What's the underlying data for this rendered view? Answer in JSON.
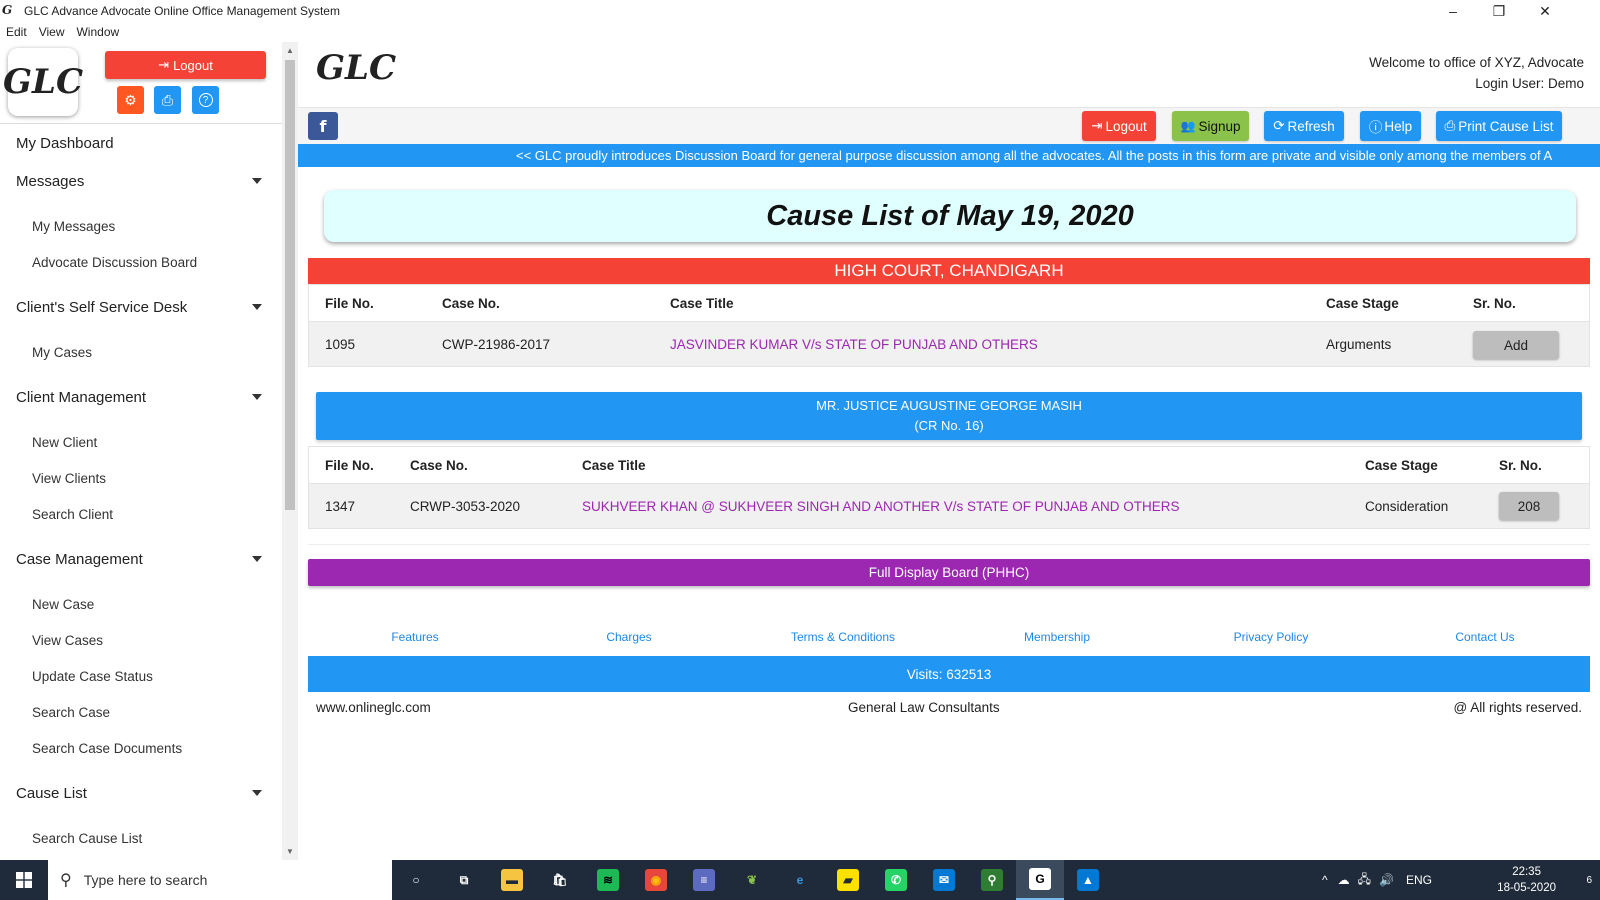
{
  "window": {
    "title": "GLC Advance Advocate Online Office Management System",
    "icon": "glc-app-icon",
    "minimize": "–",
    "restore": "❐",
    "close": "✕"
  },
  "menubar": [
    "Edit",
    "View",
    "Window"
  ],
  "sidebar": {
    "logo_text": "GLC",
    "logout_label": "Logout",
    "icon_buttons": [
      {
        "name": "settings-button",
        "icon": "gear-icon",
        "glyph": "⚙",
        "color": "#ff5722"
      },
      {
        "name": "print-button",
        "icon": "print-icon",
        "glyph": "⎙",
        "color": "#2196f3"
      },
      {
        "name": "help-button",
        "icon": "help-icon",
        "glyph": "?",
        "color": "#2196f3"
      }
    ],
    "dashboard": "My Dashboard",
    "groups": [
      {
        "label": "Messages",
        "items": [
          "My Messages",
          "Advocate Discussion Board"
        ]
      },
      {
        "label": "Client's Self Service Desk",
        "items": [
          "My Cases"
        ]
      },
      {
        "label": "Client Management",
        "items": [
          "New Client",
          "View Clients",
          "Search Client"
        ]
      },
      {
        "label": "Case Management",
        "items": [
          "New Case",
          "View Cases",
          "Update Case Status",
          "Search Case",
          "Search Case Documents"
        ]
      },
      {
        "label": "Cause List",
        "items": [
          "Search Cause List"
        ]
      }
    ]
  },
  "header": {
    "logo_text": "GLC",
    "welcome": "Welcome to office of XYZ, Advocate",
    "login_user": "Login User: Demo"
  },
  "toolbar": {
    "facebook": "f",
    "buttons": [
      {
        "name": "logout-button",
        "label": "Logout",
        "glyph": "⇥",
        "color": "#f44336"
      },
      {
        "name": "signup-button",
        "label": "Signup",
        "glyph": "👥",
        "color": "#8bc34a"
      },
      {
        "name": "refresh-button",
        "label": "Refresh",
        "glyph": "⟳",
        "color": "#2196f3"
      },
      {
        "name": "help-button",
        "label": "Help",
        "glyph": "ⓘ",
        "color": "#2196f3"
      },
      {
        "name": "print-cause-list-button",
        "label": "Print Cause List",
        "glyph": "⎙",
        "color": "#2196f3"
      }
    ]
  },
  "marquee": "<< GLC proudly introduces Discussion Board for general purpose discussion among all the advocates. All the posts in this form are private and visible only among the members of A",
  "cause_list": {
    "title": "Cause List of May 19, 2020",
    "court": "HIGH COURT, CHANDIGARH",
    "table1": {
      "headers": [
        "File No.",
        "Case No.",
        "Case Title",
        "Case Stage",
        "Sr. No."
      ],
      "rows": [
        {
          "file_no": "1095",
          "case_no": "CWP-21986-2017",
          "title": "JASVINDER KUMAR V/s STATE OF PUNJAB AND OTHERS",
          "stage": "Arguments",
          "sr": "Add"
        }
      ]
    },
    "judge": {
      "name": "MR. JUSTICE AUGUSTINE GEORGE MASIH",
      "room": "(CR No. 16)"
    },
    "table2": {
      "headers": [
        "File No.",
        "Case No.",
        "Case Title",
        "Case Stage",
        "Sr. No."
      ],
      "rows": [
        {
          "file_no": "1347",
          "case_no": "CRWP-3053-2020",
          "title": "SUKHVEER KHAN @ SUKHVEER SINGH AND ANOTHER V/s STATE OF PUNJAB AND OTHERS",
          "stage": "Consideration",
          "sr": "208"
        }
      ]
    },
    "display_board": "Full Display Board (PHHC)"
  },
  "footer": {
    "links": [
      "Features",
      "Charges",
      "Terms & Conditions",
      "Membership",
      "Privacy Policy",
      "Contact Us"
    ],
    "visits": "Visits: 632513",
    "website": "www.onlineglc.com",
    "company": "General Law Consultants",
    "rights": "@ All rights reserved."
  },
  "taskbar": {
    "search_placeholder": "Type here to search",
    "apps": [
      {
        "name": "cortana-icon",
        "glyph": "○",
        "bg": "transparent",
        "fg": "#fff"
      },
      {
        "name": "task-view-icon",
        "glyph": "⧉",
        "bg": "transparent",
        "fg": "#fff"
      },
      {
        "name": "file-explorer-icon",
        "glyph": "▬",
        "bg": "#f5c542",
        "fg": "#1f2b3a"
      },
      {
        "name": "store-icon",
        "glyph": "🛍",
        "bg": "transparent",
        "fg": "#fff"
      },
      {
        "name": "spotify-icon",
        "glyph": "≋",
        "bg": "#1db954",
        "fg": "#000"
      },
      {
        "name": "chrome-icon",
        "glyph": "◉",
        "bg": "#e8453c",
        "fg": "#fbbc05"
      },
      {
        "name": "media-app-icon",
        "glyph": "≡",
        "bg": "#5c6bc0",
        "fg": "#fff"
      },
      {
        "name": "leaf-app-icon",
        "glyph": "❦",
        "bg": "transparent",
        "fg": "#8bc34a"
      },
      {
        "name": "edge-icon",
        "glyph": "e",
        "bg": "transparent",
        "fg": "#3a96dd"
      },
      {
        "name": "sticky-notes-icon",
        "glyph": "▰",
        "bg": "#fce100",
        "fg": "#1f2b3a"
      },
      {
        "name": "whatsapp-icon",
        "glyph": "✆",
        "bg": "#25d366",
        "fg": "#fff"
      },
      {
        "name": "mail-icon",
        "glyph": "✉",
        "bg": "#0078d4",
        "fg": "#fff"
      },
      {
        "name": "maps-app-icon",
        "glyph": "⚲",
        "bg": "#2e7d32",
        "fg": "#fff"
      },
      {
        "name": "glc-app-icon",
        "glyph": "G",
        "bg": "#fff",
        "fg": "#000"
      },
      {
        "name": "photos-icon",
        "glyph": "▲",
        "bg": "#0078d4",
        "fg": "#fff"
      }
    ],
    "tray": {
      "chevron": "^",
      "cloud": "☁",
      "network": "🖧",
      "volume": "🔊",
      "lang": "ENG",
      "time": "22:35",
      "date": "18-05-2020",
      "notifications": "6"
    }
  }
}
